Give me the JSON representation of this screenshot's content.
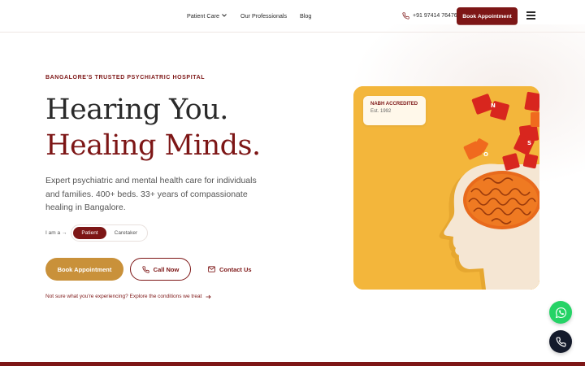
{
  "header": {
    "nav": [
      {
        "label": "Patient Care",
        "has_dropdown": true
      },
      {
        "label": "Our Professionals",
        "has_dropdown": false
      },
      {
        "label": "Blog",
        "has_dropdown": false
      }
    ],
    "phone": "+91 97414 76476",
    "book_label": "Book Appointment",
    "menu_icon": "hamburger-icon"
  },
  "hero": {
    "eyebrow": "BANGALORE'S TRUSTED PSYCHIATRIC HOSPITAL",
    "title_line1": "Hearing You.",
    "title_line2": "Healing Minds.",
    "lead": "Expert psychiatric and mental health care for individuals and families. 400+ beds. 33+ years of compassionate healing in Bangalore.",
    "iam_label": "I am a →",
    "toggle": {
      "options": [
        "Patient",
        "Caretaker"
      ],
      "selected": "Patient"
    },
    "cta_book": "Book Appointment",
    "cta_call": "Call Now",
    "cta_contact": "Contact Us",
    "explore_link": "Not sure what you're experiencing? Explore the conditions we treat"
  },
  "card": {
    "badge_title": "NABH ACCREDITED",
    "badge_sub": "Est. 1992",
    "image_subject": "head-silhouette-with-brain-and-puzzle-pieces"
  },
  "floating": {
    "whatsapp_icon": "whatsapp-icon",
    "call_icon": "phone-icon"
  },
  "colors": {
    "brand": "#7d1616",
    "accent_gold": "#c9913a",
    "card_bg": "#f2b53a",
    "whatsapp": "#25d366",
    "call_fab": "#141a2b"
  }
}
